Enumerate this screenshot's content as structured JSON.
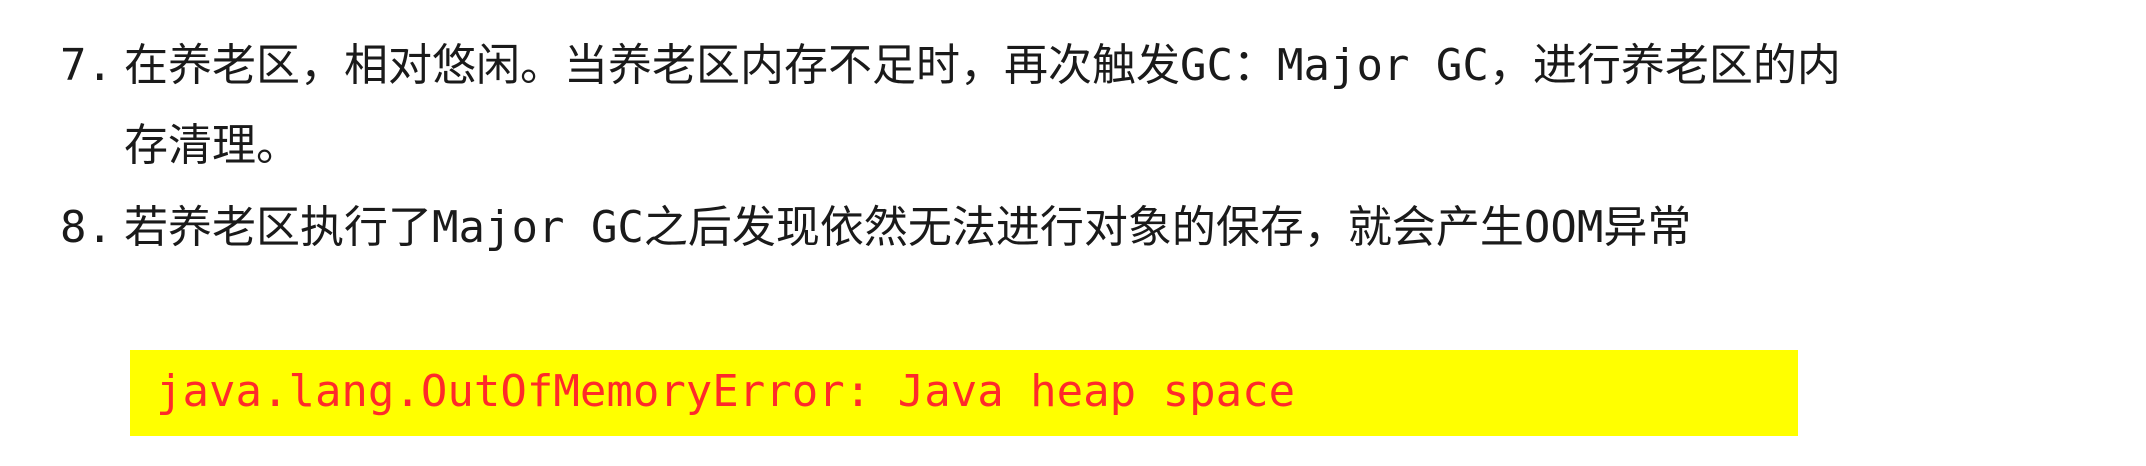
{
  "list": {
    "items": [
      {
        "number": "7.",
        "text_line1": "在养老区，相对悠闲。当养老区内存不足时，再次触发GC：Major GC，进行养老区的内",
        "text_line2": "存清理。"
      },
      {
        "number": "8.",
        "text_line1": "若养老区执行了Major GC之后发现依然无法进行对象的保存，就会产生OOM异常"
      }
    ]
  },
  "error_box": {
    "text": "java.lang.OutOfMemoryError: Java heap space",
    "background_color": "#ffff00",
    "text_color": "#ff2a2a"
  }
}
